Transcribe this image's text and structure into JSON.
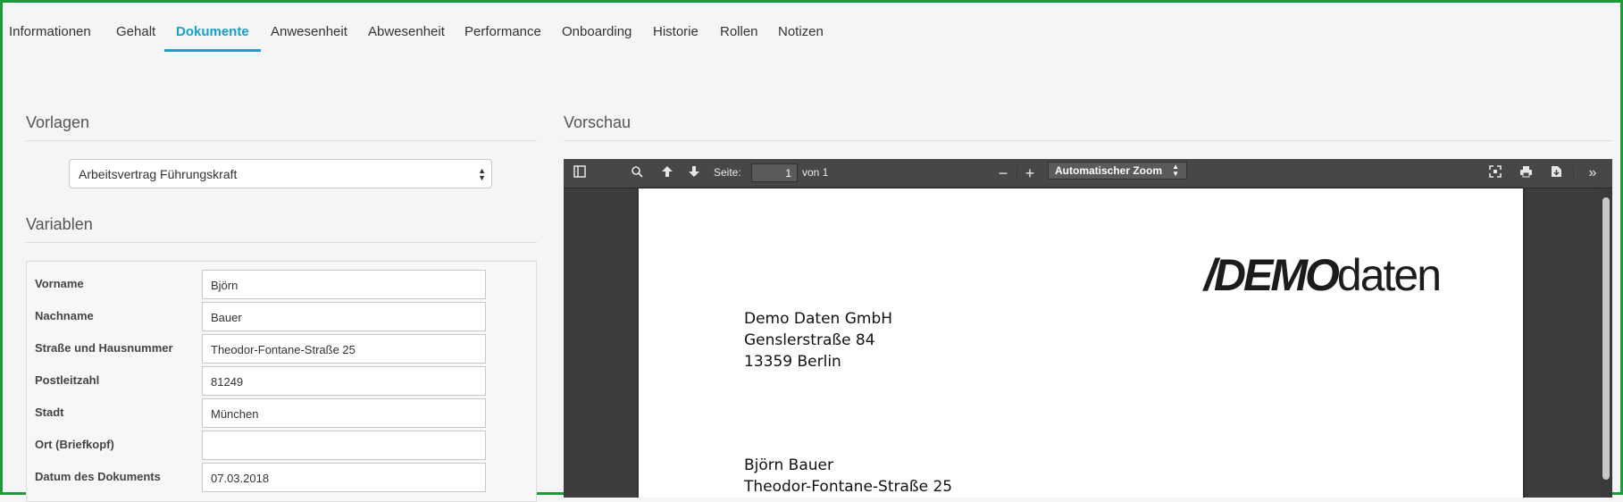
{
  "tabs": [
    {
      "label": "Informationen"
    },
    {
      "label": "Gehalt"
    },
    {
      "label": "Dokumente",
      "active": true
    },
    {
      "label": "Anwesenheit"
    },
    {
      "label": "Abwesenheit"
    },
    {
      "label": "Performance"
    },
    {
      "label": "Onboarding"
    },
    {
      "label": "Historie"
    },
    {
      "label": "Rollen"
    },
    {
      "label": "Notizen"
    }
  ],
  "templates": {
    "title": "Vorlagen",
    "selected": "Arbeitsvertrag Führungskraft"
  },
  "variables": {
    "title": "Variablen",
    "fields": [
      {
        "label": "Vorname",
        "value": "Björn"
      },
      {
        "label": "Nachname",
        "value": "Bauer"
      },
      {
        "label": "Straße und Hausnummer",
        "value": "Theodor-Fontane-Straße 25"
      },
      {
        "label": "Postleitzahl",
        "value": "81249"
      },
      {
        "label": "Stadt",
        "value": "München"
      },
      {
        "label": "Ort (Briefkopf)",
        "value": ""
      },
      {
        "label": "Datum des Dokuments",
        "value": "07.03.2018"
      }
    ]
  },
  "preview": {
    "title": "Vorschau",
    "toolbar": {
      "page_label": "Seite:",
      "page_value": "1",
      "page_total": "von 1",
      "zoom": "Automatischer Zoom",
      "icons": [
        "sidebar-toggle-icon",
        "search-icon",
        "previous-page-icon",
        "next-page-icon",
        "zoom-out-icon",
        "zoom-in-icon",
        "presentation-mode-icon",
        "print-icon",
        "download-icon",
        "tools-icon"
      ]
    },
    "document": {
      "logo_bold": "/DEMO",
      "logo_light": "daten",
      "sender": [
        "Demo Daten GmbH",
        "Genslerstraße 84",
        "13359 Berlin"
      ],
      "recipient": [
        "Björn Bauer",
        "Theodor-Fontane-Straße 25"
      ]
    }
  },
  "colors": {
    "accent": "#1aa0c9",
    "frame": "#1f9a3a",
    "viewer_bg": "#3d3d3d",
    "toolbar_bg": "#474747"
  }
}
